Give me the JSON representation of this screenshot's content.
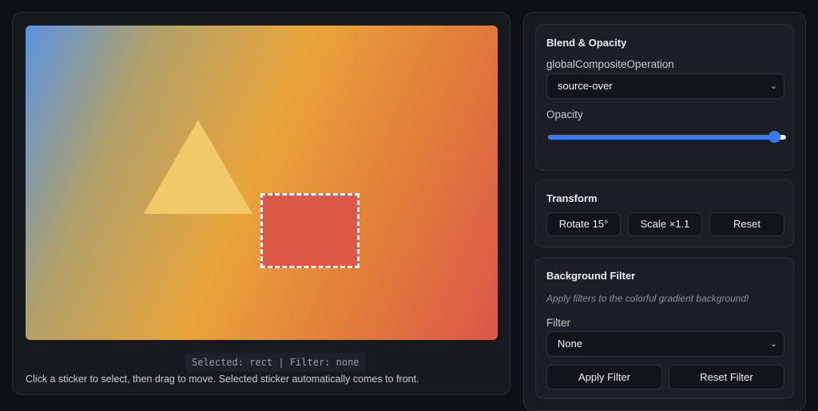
{
  "canvas": {
    "status": "Selected: rect | Filter: none",
    "hint": "Click a sticker to select, then drag to move. Selected sticker automatically comes to front.",
    "stickers": [
      {
        "name": "triangle",
        "color": "#f1c966"
      },
      {
        "name": "rect",
        "color": "#dc5a45",
        "selected": true
      }
    ]
  },
  "blend": {
    "title": "Blend & Opacity",
    "composite_label": "globalCompositeOperation",
    "composite_value": "source-over",
    "opacity_label": "Opacity",
    "opacity": 0.95
  },
  "transform": {
    "title": "Transform",
    "rotate_label": "Rotate 15°",
    "scale_label": "Scale ×1.1",
    "reset_label": "Reset"
  },
  "filter": {
    "title": "Background Filter",
    "note": "Apply filters to the colorful gradient background!",
    "filter_label": "Filter",
    "filter_value": "None",
    "apply_label": "Apply Filter",
    "reset_label": "Reset Filter"
  },
  "colors": {
    "accent": "#3a7ae8",
    "background": "#0d1015",
    "panel": "#16191e"
  }
}
